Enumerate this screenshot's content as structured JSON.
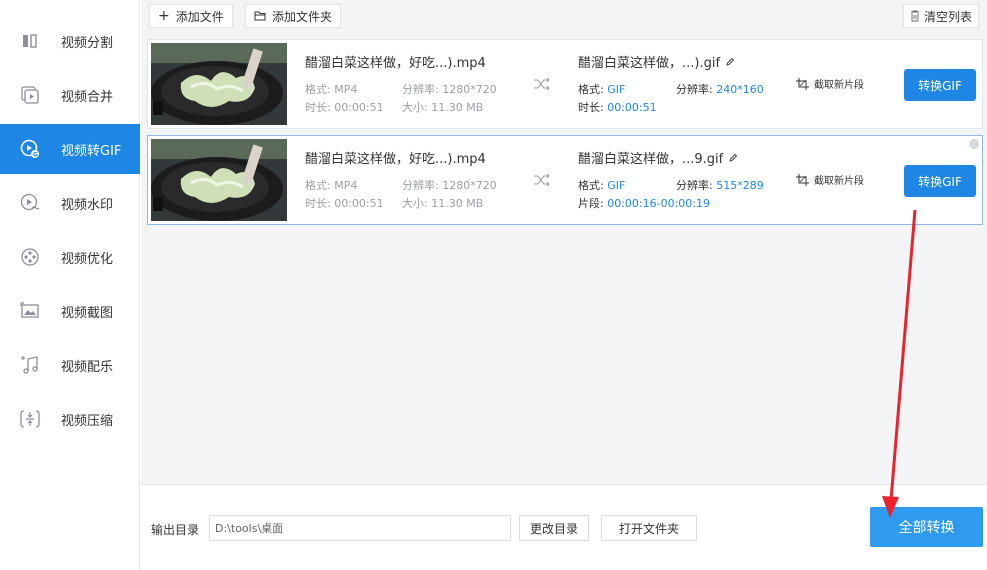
{
  "toolbar": {
    "add_file": "添加文件",
    "add_folder": "添加文件夹",
    "clear_list": "清空列表"
  },
  "sidebar": {
    "items": [
      {
        "label": "视频分割",
        "icon": "split-icon"
      },
      {
        "label": "视频合并",
        "icon": "merge-icon"
      },
      {
        "label": "视频转GIF",
        "icon": "gif-icon",
        "active": true
      },
      {
        "label": "视频水印",
        "icon": "watermark-icon"
      },
      {
        "label": "视频优化",
        "icon": "optimize-icon"
      },
      {
        "label": "视频截图",
        "icon": "screenshot-icon"
      },
      {
        "label": "视频配乐",
        "icon": "music-icon"
      },
      {
        "label": "视频压缩",
        "icon": "compress-icon"
      }
    ]
  },
  "files": [
    {
      "input_name": "醋溜白菜这样做，好吃...).mp4",
      "format_label": "格式:",
      "format": "MP4",
      "resolution_label": "分辨率:",
      "resolution": "1280*720",
      "duration_label": "时长:",
      "duration": "00:00:51",
      "size_label": "大小:",
      "size": "11.30 MB",
      "output_name": "醋溜白菜这样做，...).gif",
      "out_format_label": "格式:",
      "out_format": "GIF",
      "out_resolution_label": "分辨率:",
      "out_resolution": "240*160",
      "out_extra_label": "时长:",
      "out_extra": "00:00:51",
      "clip_label": "截取新片段",
      "convert_label": "转换GIF"
    },
    {
      "input_name": "醋溜白菜这样做，好吃...).mp4",
      "format_label": "格式:",
      "format": "MP4",
      "resolution_label": "分辨率:",
      "resolution": "1280*720",
      "duration_label": "时长:",
      "duration": "00:00:51",
      "size_label": "大小:",
      "size": "11.30 MB",
      "output_name": "醋溜白菜这样做，...9.gif",
      "out_format_label": "格式:",
      "out_format": "GIF",
      "out_resolution_label": "分辨率:",
      "out_resolution": "515*289",
      "out_extra_label": "片段:",
      "out_extra": "00:00:16-00:00:19",
      "clip_label": "截取新片段",
      "convert_label": "转换GIF"
    }
  ],
  "bottom": {
    "output_label": "输出目录",
    "output_path": "D:\\tools\\桌面",
    "change_dir": "更改目录",
    "open_folder": "打开文件夹",
    "convert_all": "全部转换"
  },
  "colors": {
    "accent": "#1e87e6",
    "annotation_arrow": "#e8242a"
  }
}
